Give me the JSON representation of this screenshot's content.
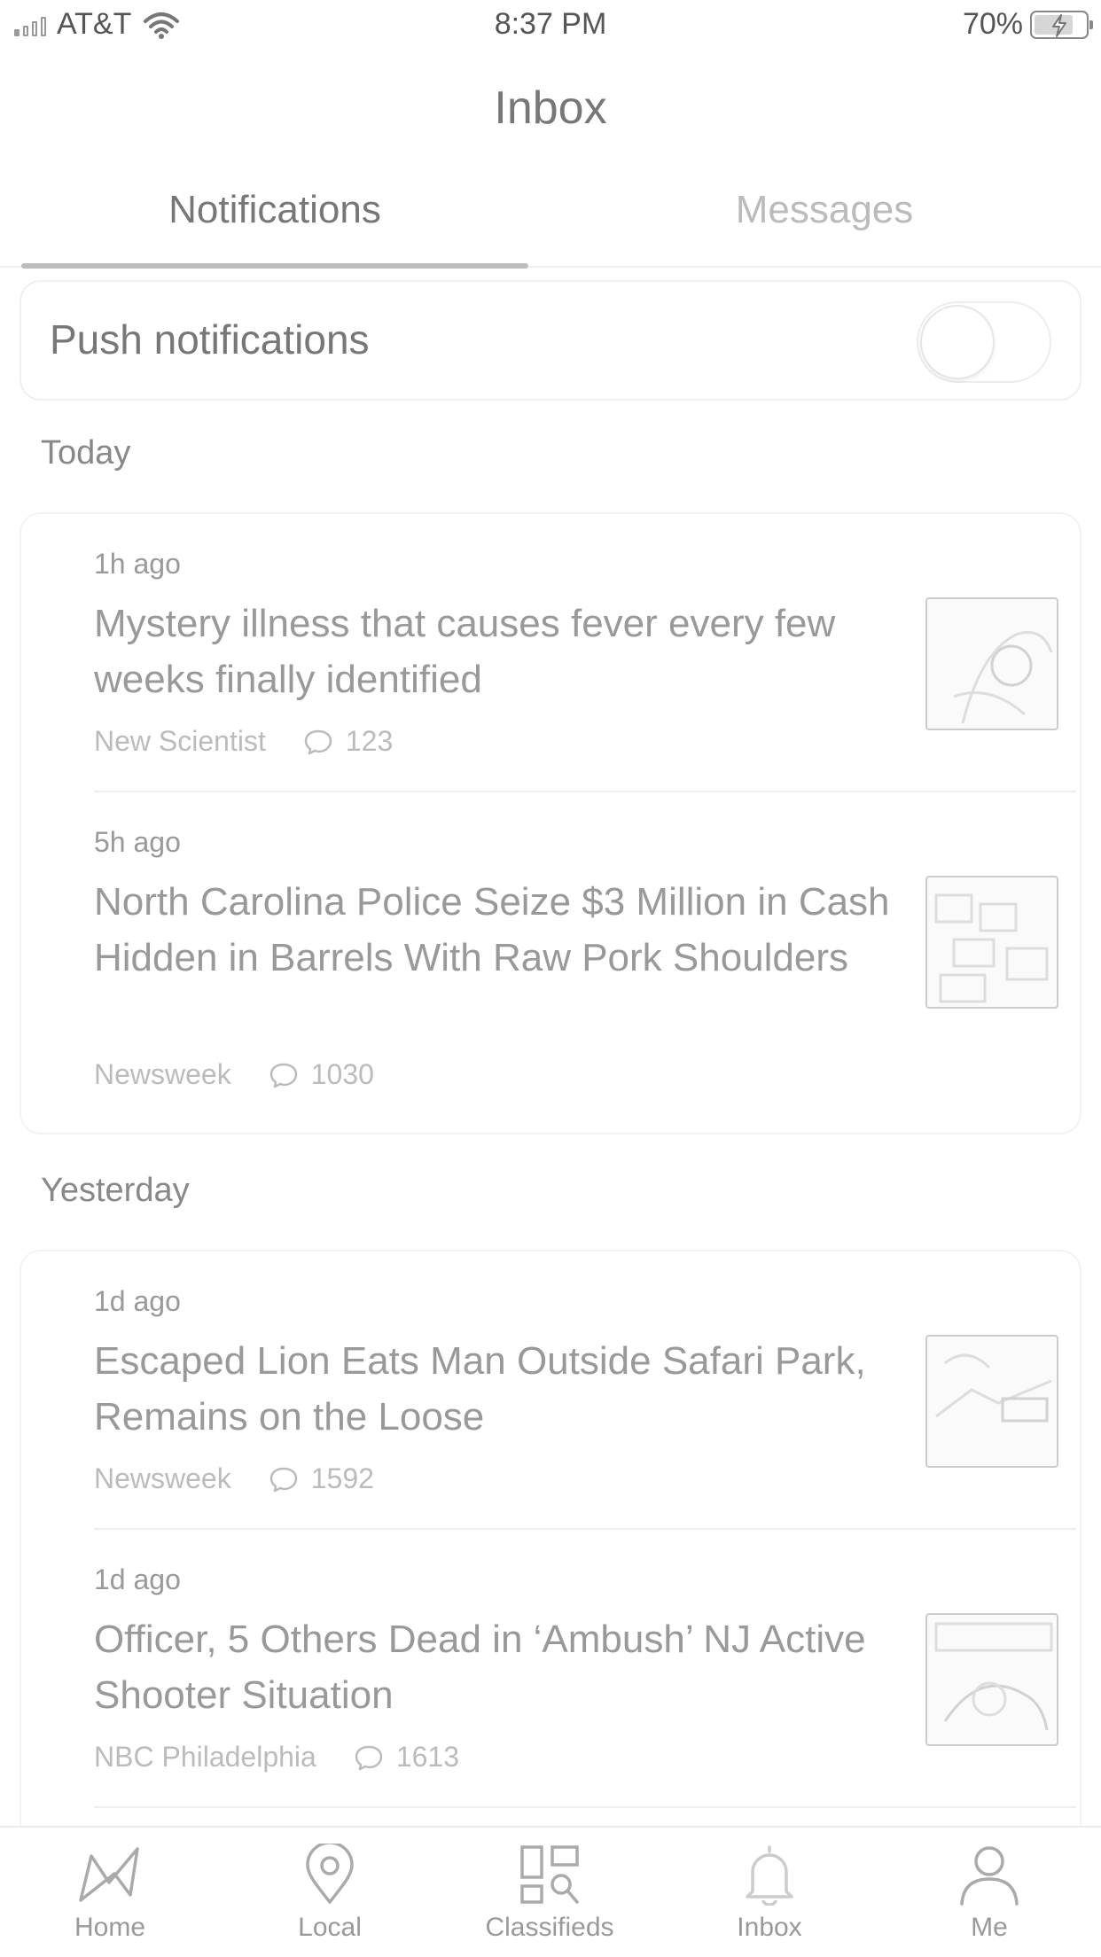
{
  "status_bar": {
    "carrier": "AT&T",
    "time": "8:37 PM",
    "battery_percent": "70%"
  },
  "header": {
    "title": "Inbox"
  },
  "tabs": [
    {
      "label": "Notifications",
      "active": true
    },
    {
      "label": "Messages",
      "active": false
    }
  ],
  "push": {
    "label": "Push notifications",
    "enabled": false
  },
  "sections": [
    {
      "label": "Today",
      "items": [
        {
          "time": "1h ago",
          "title": "Mystery illness that causes fever every few weeks finally identified",
          "source": "New Scientist",
          "comments": "123"
        },
        {
          "time": "5h ago",
          "title": "North Carolina Police Seize $3 Million in Cash Hidden in Barrels With Raw Pork Shoulders",
          "source": "Newsweek",
          "comments": "1030"
        }
      ]
    },
    {
      "label": "Yesterday",
      "items": [
        {
          "time": "1d ago",
          "title": "Escaped Lion Eats Man Outside Safari Park, Remains on the Loose",
          "source": "Newsweek",
          "comments": "1592"
        },
        {
          "time": "1d ago",
          "title": "Officer, 5 Others Dead in ‘Ambush’ NJ Active Shooter Situation",
          "source": "NBC Philadelphia",
          "comments": "1613"
        }
      ]
    }
  ],
  "tab_bar": [
    {
      "label": "Home",
      "icon": "home-icon"
    },
    {
      "label": "Local",
      "icon": "location-pin-icon"
    },
    {
      "label": "Classifieds",
      "icon": "classifieds-icon"
    },
    {
      "label": "Inbox",
      "icon": "bell-icon"
    },
    {
      "label": "Me",
      "icon": "person-icon"
    }
  ]
}
